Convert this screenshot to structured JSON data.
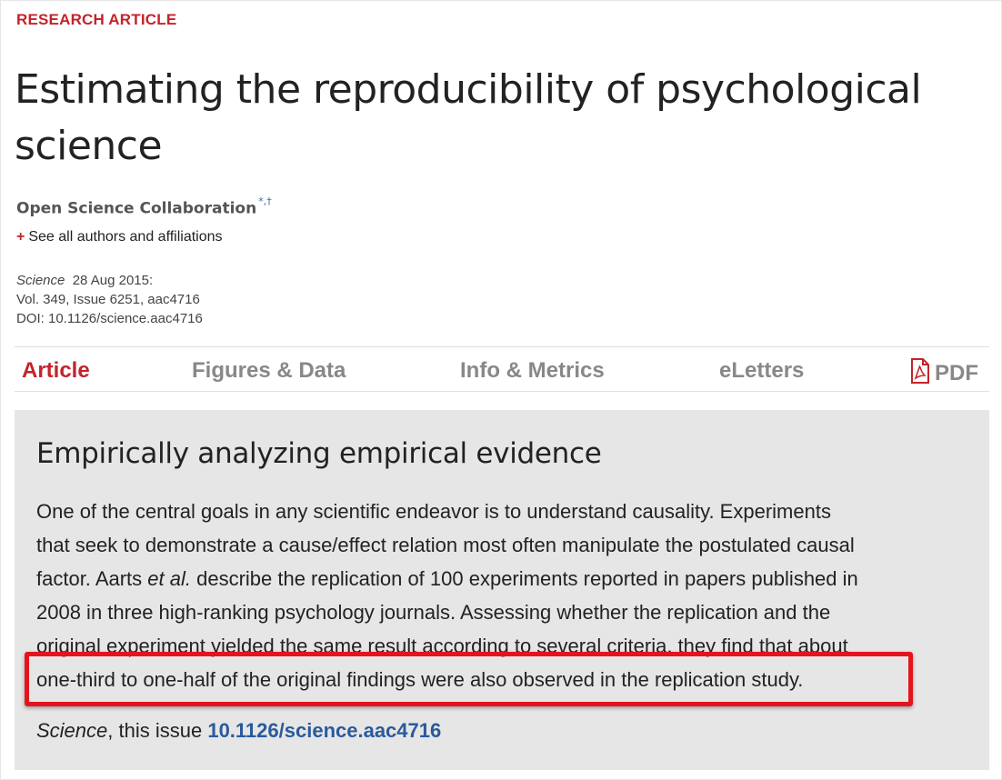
{
  "header": {
    "section_label": "RESEARCH ARTICLE",
    "title": "Estimating the reproducibility of psychological science",
    "authors": "Open Science Collaboration",
    "author_marks": "*,†",
    "see_all_label": "See all authors and affiliations",
    "see_all_prefix": "+"
  },
  "citation": {
    "journal": "Science",
    "date": "28 Aug 2015:",
    "volume_line": "Vol. 349, Issue 6251, aac4716",
    "doi_line": "DOI: 10.1126/science.aac4716"
  },
  "tabs": [
    {
      "label": "Article",
      "active": true
    },
    {
      "label": "Figures & Data",
      "active": false
    },
    {
      "label": "Info & Metrics",
      "active": false
    },
    {
      "label": "eLetters",
      "active": false
    },
    {
      "label": "PDF",
      "active": false,
      "icon": "pdf-icon"
    }
  ],
  "summary": {
    "heading": "Empirically analyzing empirical evidence",
    "lines": {
      "l1": "One of the central goals in any scientific endeavor is to understand causality. Experiments",
      "l2": "that seek to demonstrate a cause/effect relation most often manipulate the postulated causal",
      "l3_pre": "factor. Aarts ",
      "l3_em": "et al.",
      "l3_post": " describe the replication of 100 experiments reported in papers published in",
      "l4": "2008 in three high-ranking psychology journals. Assessing whether the replication and the",
      "l5": "original experiment yielded the same result according to several criteria, they find that about",
      "l6": "one-third to one-half of the original findings were also observed in the replication study."
    },
    "ref_journal": "Science",
    "ref_text": ", this issue ",
    "ref_doi": "10.1126/science.aac4716"
  },
  "colors": {
    "accent": "#c4232a",
    "highlight_border": "#e5141c",
    "link": "#2a5a9c",
    "summary_bg": "#e6e6e6"
  }
}
